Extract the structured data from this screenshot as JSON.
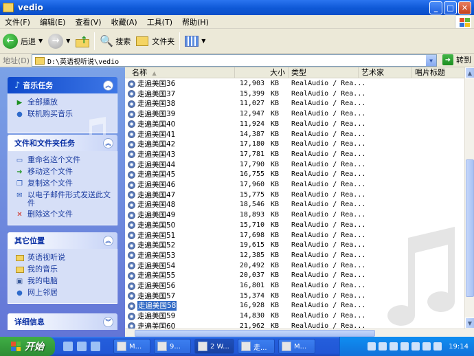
{
  "window": {
    "title": "vedio"
  },
  "menu": [
    "文件(F)",
    "编辑(E)",
    "查看(V)",
    "收藏(A)",
    "工具(T)",
    "帮助(H)"
  ],
  "toolbar": {
    "back": "后退",
    "search": "搜索",
    "folders": "文件夹"
  },
  "address": {
    "label": "地址(D)",
    "value": "D:\\英语视听说\\vedio",
    "go": "转到"
  },
  "panels": {
    "music": {
      "title": "音乐任务",
      "items": [
        "全部播放",
        "联机购买音乐"
      ]
    },
    "file": {
      "title": "文件和文件夹任务",
      "items": [
        "重命名这个文件",
        "移动这个文件",
        "复制这个文件",
        "以电子邮件形式发送此文件",
        "删除这个文件"
      ]
    },
    "other": {
      "title": "其它位置",
      "items": [
        "英语视听说",
        "我的音乐",
        "我的电脑",
        "网上邻居"
      ]
    },
    "details": {
      "title": "详细信息"
    }
  },
  "columns": {
    "name": "名称",
    "size": "大小",
    "type": "类型",
    "artist": "艺术家",
    "album": "唱片标题"
  },
  "files": [
    {
      "name": "走遍美国36",
      "size": "12,903",
      "unit": "KB",
      "type": "RealAudio / Rea..."
    },
    {
      "name": "走遍美国37",
      "size": "15,399",
      "unit": "KB",
      "type": "RealAudio / Rea..."
    },
    {
      "name": "走遍美国38",
      "size": "11,027",
      "unit": "KB",
      "type": "RealAudio / Rea..."
    },
    {
      "name": "走遍美国39",
      "size": "12,947",
      "unit": "KB",
      "type": "RealAudio / Rea..."
    },
    {
      "name": "走遍美国40",
      "size": "11,924",
      "unit": "KB",
      "type": "RealAudio / Rea..."
    },
    {
      "name": "走遍美国41",
      "size": "14,387",
      "unit": "KB",
      "type": "RealAudio / Rea..."
    },
    {
      "name": "走遍美国42",
      "size": "17,180",
      "unit": "KB",
      "type": "RealAudio / Rea..."
    },
    {
      "name": "走遍美国43",
      "size": "17,781",
      "unit": "KB",
      "type": "RealAudio / Rea..."
    },
    {
      "name": "走遍美国44",
      "size": "17,790",
      "unit": "KB",
      "type": "RealAudio / Rea..."
    },
    {
      "name": "走遍美国45",
      "size": "16,755",
      "unit": "KB",
      "type": "RealAudio / Rea..."
    },
    {
      "name": "走遍美国46",
      "size": "17,960",
      "unit": "KB",
      "type": "RealAudio / Rea..."
    },
    {
      "name": "走遍美国47",
      "size": "15,775",
      "unit": "KB",
      "type": "RealAudio / Rea..."
    },
    {
      "name": "走遍美国48",
      "size": "18,546",
      "unit": "KB",
      "type": "RealAudio / Rea..."
    },
    {
      "name": "走遍美国49",
      "size": "18,893",
      "unit": "KB",
      "type": "RealAudio / Rea..."
    },
    {
      "name": "走遍美国50",
      "size": "15,710",
      "unit": "KB",
      "type": "RealAudio / Rea..."
    },
    {
      "name": "走遍美国51",
      "size": "17,698",
      "unit": "KB",
      "type": "RealAudio / Rea..."
    },
    {
      "name": "走遍美国52",
      "size": "19,615",
      "unit": "KB",
      "type": "RealAudio / Rea..."
    },
    {
      "name": "走遍美国53",
      "size": "12,385",
      "unit": "KB",
      "type": "RealAudio / Rea..."
    },
    {
      "name": "走遍美国54",
      "size": "20,492",
      "unit": "KB",
      "type": "RealAudio / Rea..."
    },
    {
      "name": "走遍美国55",
      "size": "20,037",
      "unit": "KB",
      "type": "RealAudio / Rea..."
    },
    {
      "name": "走遍美国56",
      "size": "16,801",
      "unit": "KB",
      "type": "RealAudio / Rea..."
    },
    {
      "name": "走遍美国57",
      "size": "15,374",
      "unit": "KB",
      "type": "RealAudio / Rea..."
    },
    {
      "name": "走遍美国58",
      "size": "16,928",
      "unit": "KB",
      "type": "RealAudio / Rea..."
    },
    {
      "name": "走遍美国59",
      "size": "14,830",
      "unit": "KB",
      "type": "RealAudio / Rea..."
    },
    {
      "name": "走遍美国60",
      "size": "21,962",
      "unit": "KB",
      "type": "RealAudio / Rea..."
    }
  ],
  "taskbar": {
    "start": "开始",
    "tasks": [
      "M...",
      "9...",
      "2 W...",
      "走...",
      "M..."
    ],
    "clock": "19:14"
  }
}
